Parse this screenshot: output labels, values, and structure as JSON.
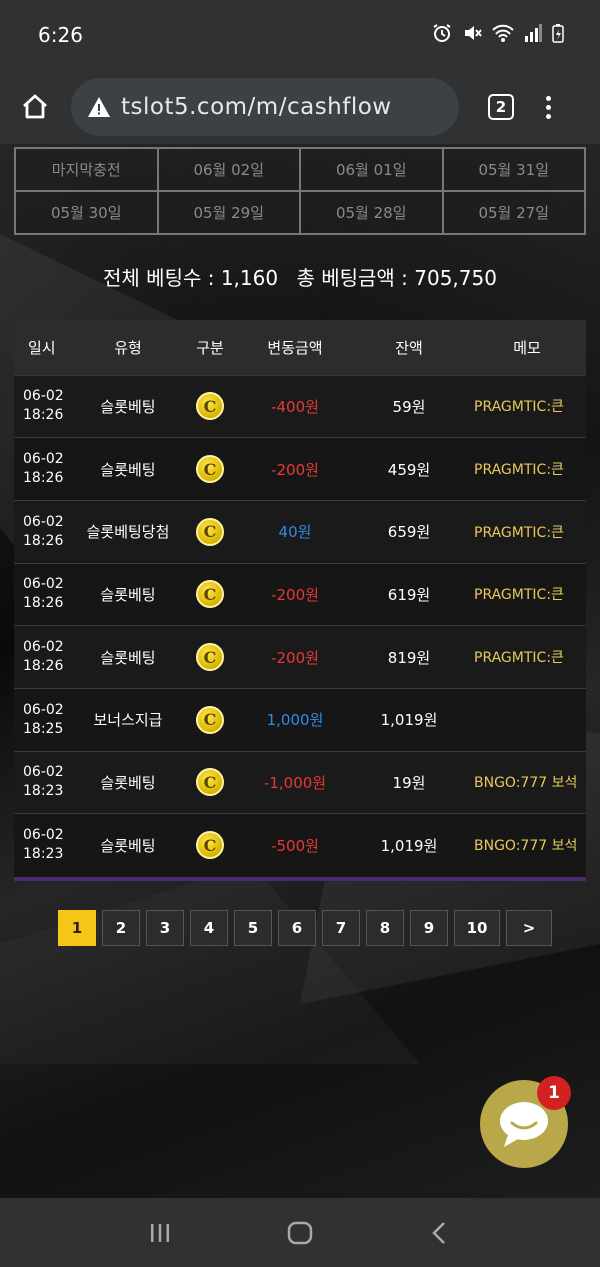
{
  "status": {
    "time": "6:26"
  },
  "browser": {
    "url": "tslot5.com/m/cashflow",
    "tab_count": "2"
  },
  "dates": [
    "마지막충전",
    "06월 02일",
    "06월 01일",
    "05월 31일",
    "05월 30일",
    "05월 29일",
    "05월 28일",
    "05월 27일"
  ],
  "summary": {
    "bet_count": "전체 베팅수 : 1,160",
    "bet_amount": "총 베팅금액 : 705,750"
  },
  "table": {
    "headers": [
      "일시",
      "유형",
      "구분",
      "변동금액",
      "잔액",
      "메모"
    ],
    "rows": [
      {
        "date": "06-02",
        "time": "18:26",
        "type": "슬롯베팅",
        "coin": "C",
        "amount": "-400원",
        "balance": "59원",
        "memo": "PRAGMTIC:큰"
      },
      {
        "date": "06-02",
        "time": "18:26",
        "type": "슬롯베팅",
        "coin": "C",
        "amount": "-200원",
        "balance": "459원",
        "memo": "PRAGMTIC:큰"
      },
      {
        "date": "06-02",
        "time": "18:26",
        "type": "슬롯베팅당첨",
        "coin": "C",
        "amount": "40원",
        "balance": "659원",
        "memo": "PRAGMTIC:큰"
      },
      {
        "date": "06-02",
        "time": "18:26",
        "type": "슬롯베팅",
        "coin": "C",
        "amount": "-200원",
        "balance": "619원",
        "memo": "PRAGMTIC:큰"
      },
      {
        "date": "06-02",
        "time": "18:26",
        "type": "슬롯베팅",
        "coin": "C",
        "amount": "-200원",
        "balance": "819원",
        "memo": "PRAGMTIC:큰"
      },
      {
        "date": "06-02",
        "time": "18:25",
        "type": "보너스지급",
        "coin": "C",
        "amount": "1,000원",
        "balance": "1,019원",
        "memo": ""
      },
      {
        "date": "06-02",
        "time": "18:23",
        "type": "슬롯베팅",
        "coin": "C",
        "amount": "-1,000원",
        "balance": "19원",
        "memo": "BNGO:777 보석"
      },
      {
        "date": "06-02",
        "time": "18:23",
        "type": "슬롯베팅",
        "coin": "C",
        "amount": "-500원",
        "balance": "1,019원",
        "memo": "BNGO:777 보석"
      }
    ]
  },
  "pager": {
    "pages": [
      "1",
      "2",
      "3",
      "4",
      "5",
      "6",
      "7",
      "8",
      "9",
      "10"
    ],
    "next": ">",
    "active": "1"
  },
  "chat": {
    "badge": "1"
  },
  "colors": {
    "negative": "#e53935",
    "positive": "#2f8be6",
    "memo": "#e8c85a",
    "active_page": "#f5c518"
  }
}
